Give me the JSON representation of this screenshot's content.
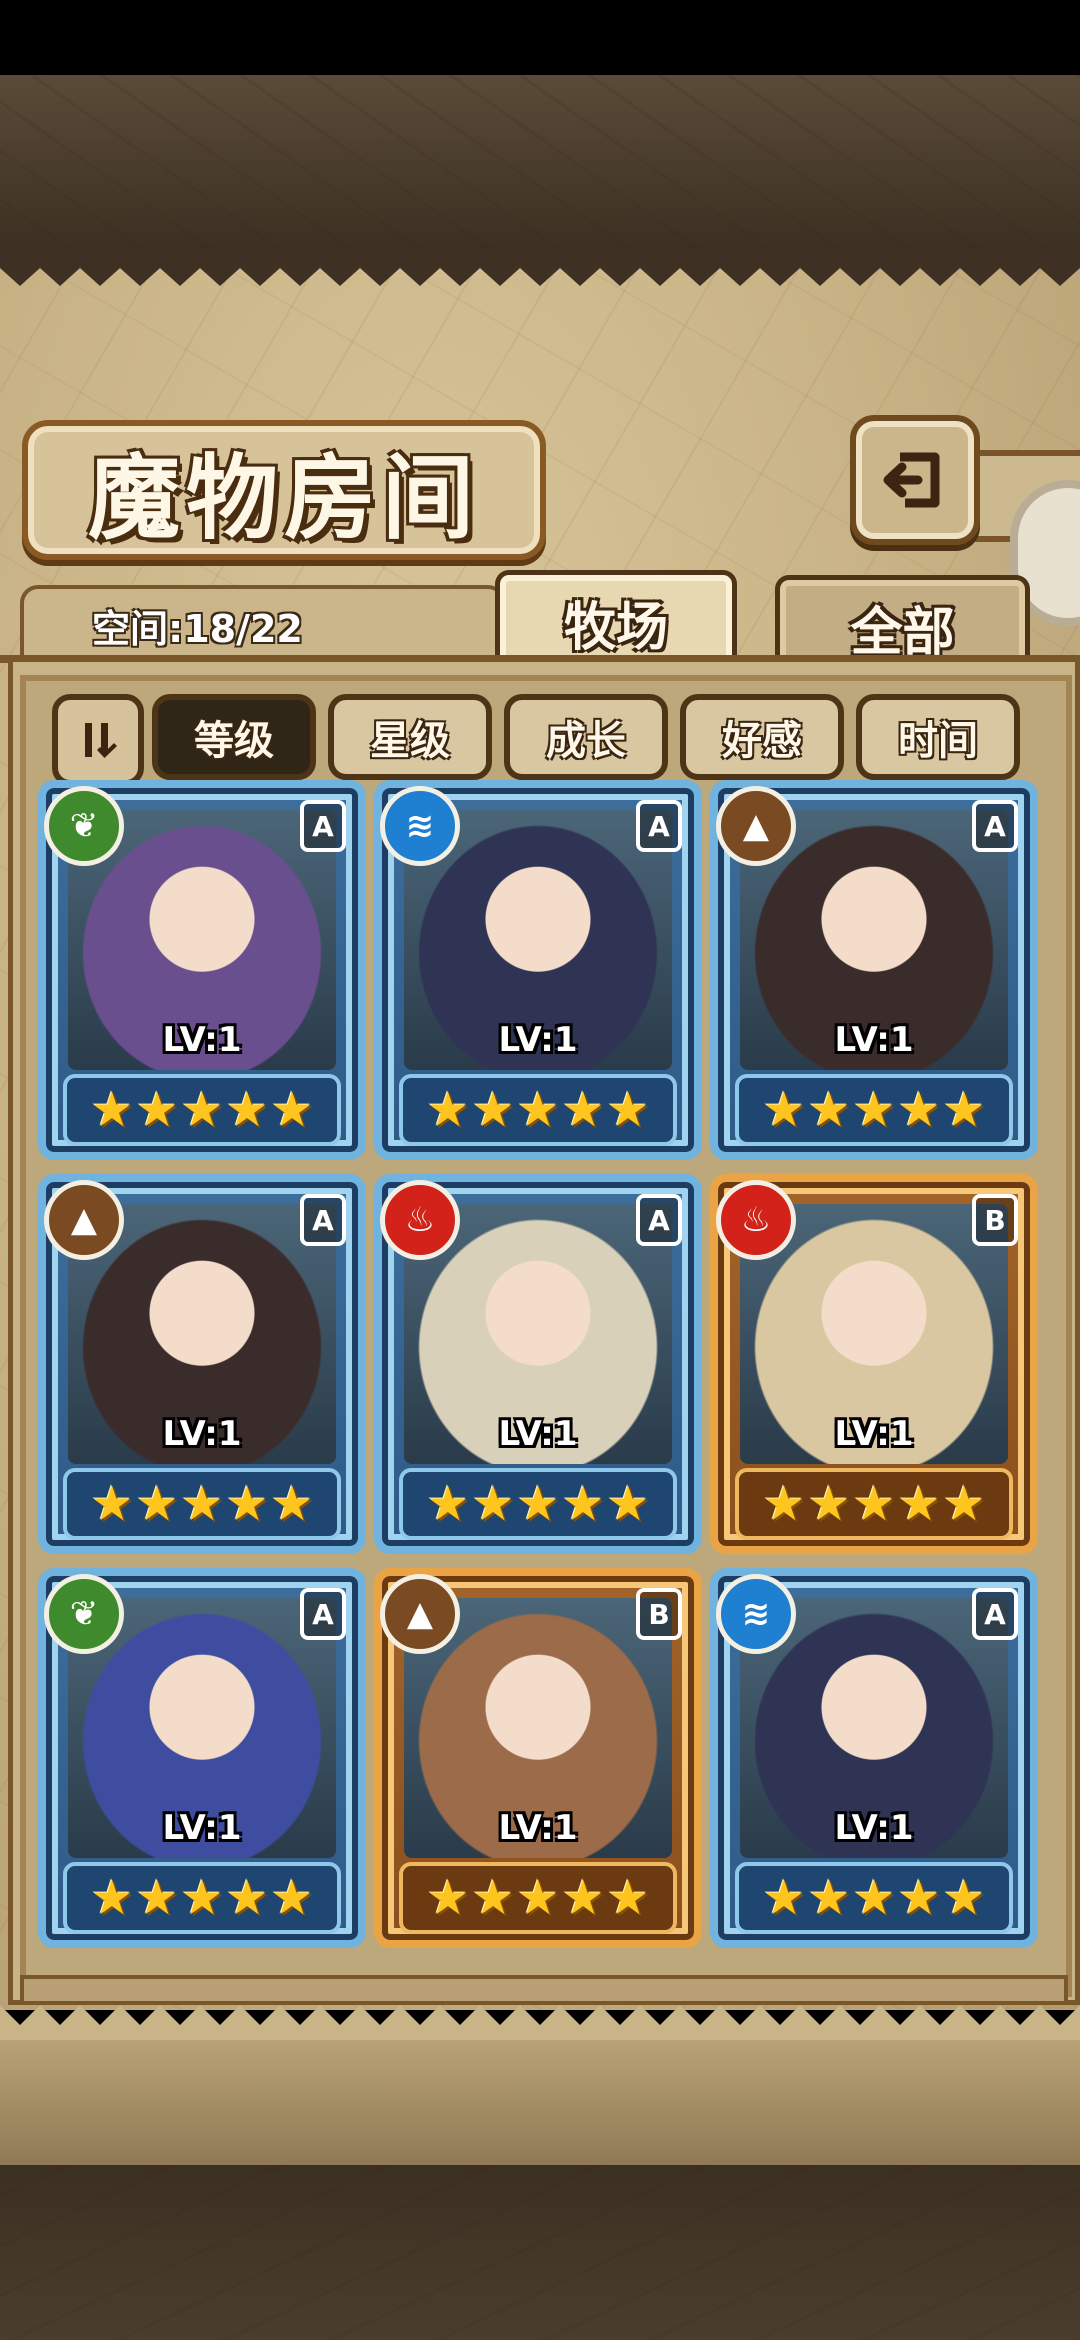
{
  "header": {
    "title": "魔物房间"
  },
  "space": {
    "label": "空间:18/22"
  },
  "tabs": [
    {
      "label": "牧场",
      "active": true
    },
    {
      "label": "全部",
      "active": false
    }
  ],
  "filters": [
    {
      "label": "等级",
      "active": true
    },
    {
      "label": "星级",
      "active": false
    },
    {
      "label": "成长",
      "active": false
    },
    {
      "label": "好感",
      "active": false
    },
    {
      "label": "时间",
      "active": false
    }
  ],
  "cards": [
    {
      "element": "earth",
      "rank": "A",
      "level": "LV:1",
      "stars": 5,
      "frame": "blue"
    },
    {
      "element": "water",
      "rank": "A",
      "level": "LV:1",
      "stars": 5,
      "frame": "blue"
    },
    {
      "element": "rock",
      "rank": "A",
      "level": "LV:1",
      "stars": 5,
      "frame": "blue"
    },
    {
      "element": "rock",
      "rank": "A",
      "level": "LV:1",
      "stars": 5,
      "frame": "blue"
    },
    {
      "element": "fire",
      "rank": "A",
      "level": "LV:1",
      "stars": 5,
      "frame": "blue"
    },
    {
      "element": "fire",
      "rank": "B",
      "level": "LV:1",
      "stars": 5,
      "frame": "gold"
    },
    {
      "element": "earth",
      "rank": "A",
      "level": "LV:1",
      "stars": 5,
      "frame": "blue"
    },
    {
      "element": "rock",
      "rank": "B",
      "level": "LV:1",
      "stars": 5,
      "frame": "gold"
    },
    {
      "element": "water",
      "rank": "A",
      "level": "LV:1",
      "stars": 5,
      "frame": "blue"
    }
  ],
  "element_colors": {
    "earth": "#3f8a2c",
    "water": "#1f7fd1",
    "rock": "#7a4a22",
    "fire": "#d3221a"
  },
  "element_icons": {
    "earth": "leaf-icon",
    "water": "wave-icon",
    "rock": "mountain-icon",
    "fire": "flame-icon"
  },
  "portrait_colors": [
    "#6a4f8e",
    "#2f3354",
    "#3b2c2c",
    "#3b2c2c",
    "#d8d0b8",
    "#d8c7a0",
    "#3f4da0",
    "#9b6b4a",
    "#2f3354"
  ]
}
